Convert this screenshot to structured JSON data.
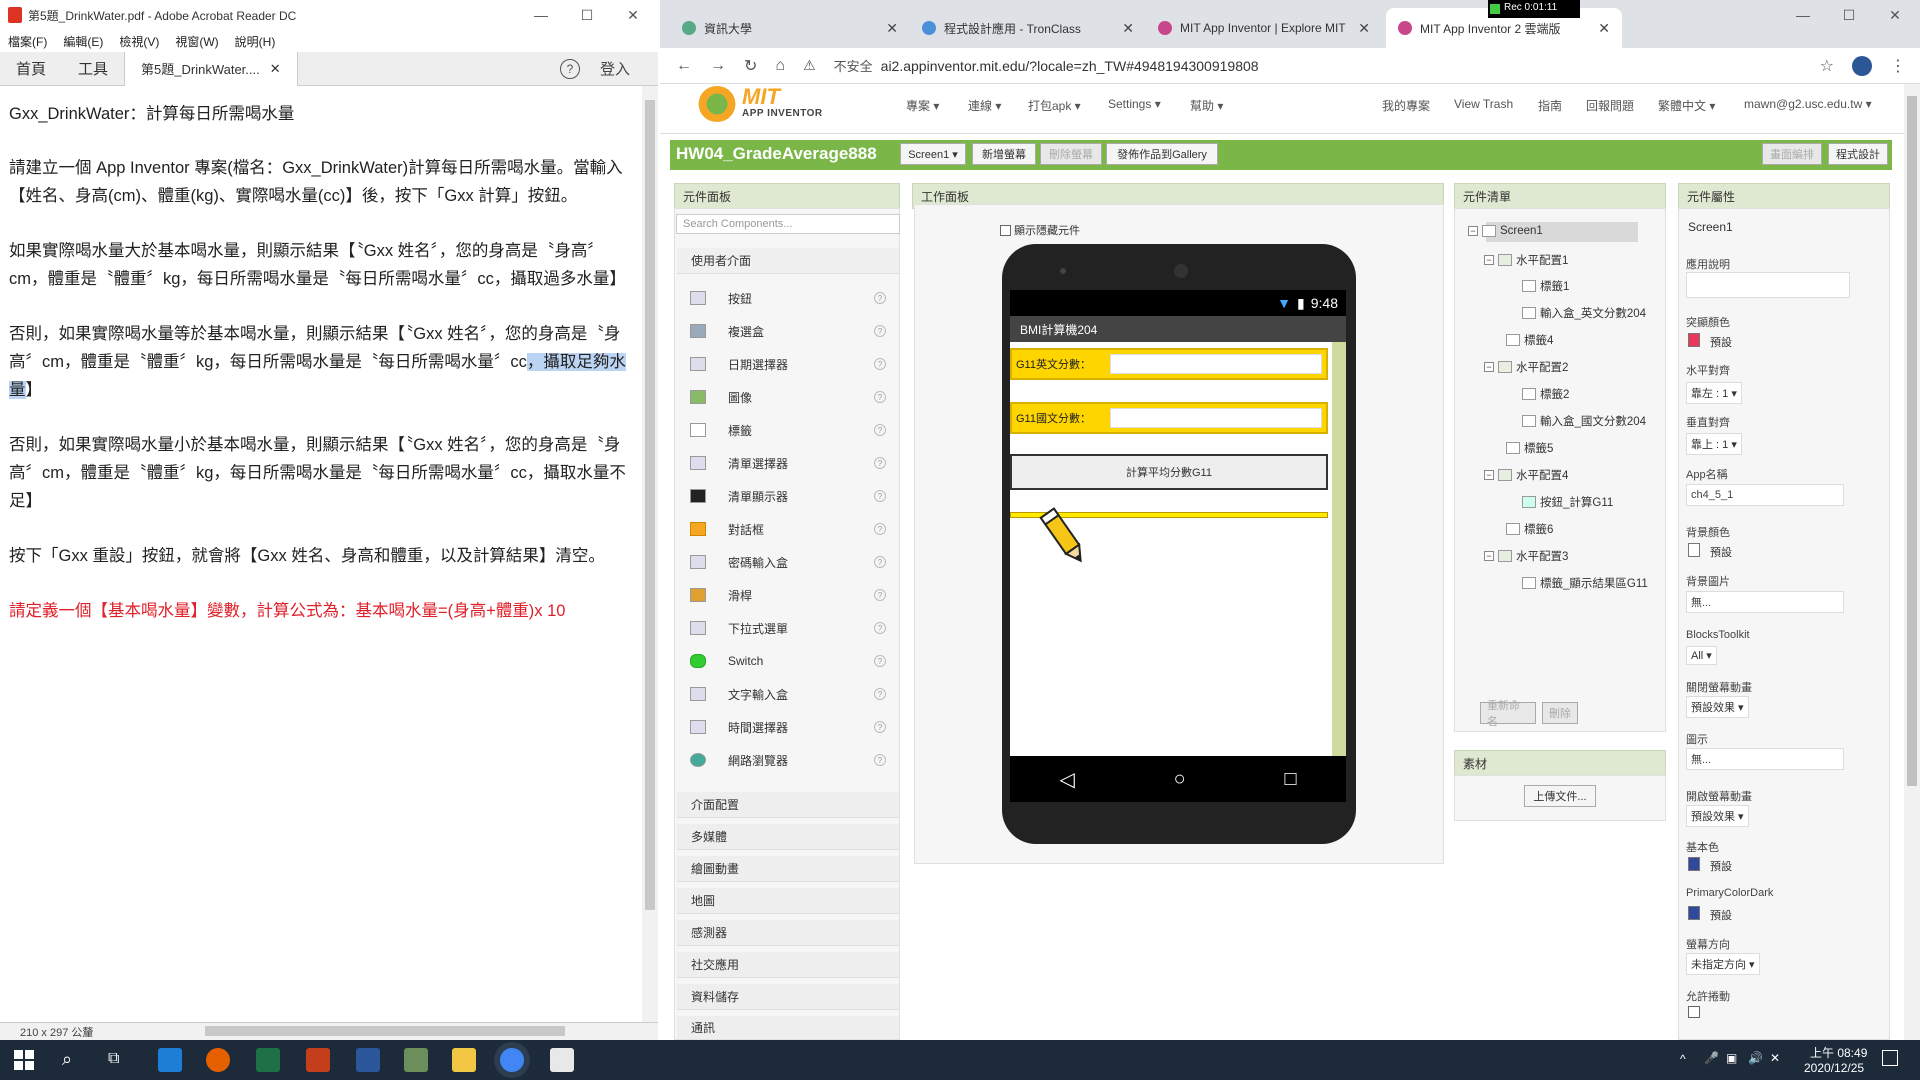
{
  "acrobat": {
    "title": "第5題_DrinkWater.pdf - Adobe Acrobat Reader DC",
    "menu": [
      "檔案(F)",
      "編輯(E)",
      "檢視(V)",
      "視窗(W)",
      "說明(H)"
    ],
    "tabs": {
      "home": "首頁",
      "tools": "工具",
      "doc": "第5題_DrinkWater....",
      "login": "登入"
    },
    "doc": {
      "p1": "Gxx_DrinkWater：計算每日所需喝水量",
      "p2": "請建立一個 App Inventor 專案(檔名：Gxx_DrinkWater)計算每日所需喝水量。當輸入【姓名、身高(cm)、體重(kg)、實際喝水量(cc)】後，按下「Gxx 計算」按鈕。",
      "p3": "如果實際喝水量大於基本喝水量，則顯示結果【〝Gxx 姓名〞，您的身高是〝身高〞cm，體重是〝體重〞kg，每日所需喝水量是〝每日所需喝水量〞cc，攝取過多水量】",
      "p4a": "否則，如果實際喝水量等於基本喝水量，則顯示結果【〝Gxx 姓名〞，您的身高是〝身高〞cm，體重是〝體重〞kg，每日所需喝水量是〝每日所需喝水量〞cc",
      "p4b": "，攝取足夠水量",
      "p4c": "】",
      "p5": "否則，如果實際喝水量小於基本喝水量，則顯示結果【〝Gxx 姓名〞，您的身高是〝身高〞cm，體重是〝體重〞kg，每日所需喝水量是〝每日所需喝水量〞cc，攝取水量不足】",
      "p6": "按下「Gxx 重設」按鈕，就會將【Gxx 姓名、身高和體重，以及計算結果】清空。",
      "p7": "請定義一個【基本喝水量】變數，計算公式為：基本喝水量=(身高+體重)x 10"
    },
    "status": "210 x 297 公釐"
  },
  "chrome": {
    "tabs": [
      "資訊大學",
      "程式設計應用 - TronClass",
      "MIT App Inventor | Explore MIT",
      "MIT App Inventor 2 雲端版"
    ],
    "not_secure": "不安全",
    "url": "ai2.appinventor.mit.edu/?locale=zh_TW#4948194300919808",
    "rec": "Rec 0:01:11"
  },
  "ai": {
    "logo_main": "MIT",
    "logo_sub": "APP INVENTOR",
    "menus": [
      "專案 ▾",
      "連線 ▾",
      "打包apk ▾",
      "Settings ▾",
      "幫助 ▾"
    ],
    "right_menus": [
      "我的專案",
      "View Trash",
      "指南",
      "回報問題",
      "繁體中文 ▾",
      "mawn@g2.usc.edu.tw ▾"
    ],
    "project": "HW04_GradeAverage888",
    "buttons": [
      "Screen1 ▾",
      "新增螢幕",
      "刪除螢幕",
      "發佈作品到Gallery"
    ],
    "right_buttons": [
      "畫面編排",
      "程式設計"
    ],
    "palette": {
      "title": "元件面板",
      "search": "Search Components...",
      "ui_cat": "使用者介面",
      "items": [
        "按鈕",
        "複選盒",
        "日期選擇器",
        "圖像",
        "標籤",
        "清單選擇器",
        "清單顯示器",
        "對話框",
        "密碼輸入盒",
        "滑桿",
        "下拉式選單",
        "Switch",
        "文字輸入盒",
        "時間選擇器",
        "網路瀏覽器"
      ],
      "cats": [
        "介面配置",
        "多媒體",
        "繪圖動畫",
        "地圖",
        "感測器",
        "社交應用",
        "資料儲存",
        "通訊"
      ]
    },
    "viewer": {
      "title": "工作面板",
      "checkbox": "顯示隱藏元件",
      "phone_time": "9:48",
      "app_title": "BMI計算機204",
      "row1": "G11英文分數：",
      "row2": "G11國文分數：",
      "button": "計算平均分數G11"
    },
    "tree": {
      "title": "元件清單",
      "nodes": [
        "Screen1",
        "水平配置1",
        "標籤1",
        "輸入盒_英文分數204",
        "標籤4",
        "水平配置2",
        "標籤2",
        "輸入盒_國文分數204",
        "標籤5",
        "水平配置4",
        "按鈕_計算G11",
        "標籤6",
        "水平配置3",
        "標籤_顯示結果區G11"
      ],
      "rename": "重新命名",
      "delete": "刪除",
      "media": "素材",
      "upload": "上傳文件..."
    },
    "props": {
      "title": "元件屬性",
      "component": "Screen1",
      "labels": [
        "應用說明",
        "突顯顏色",
        "水平對齊",
        "垂直對齊",
        "App名稱",
        "背景顏色",
        "背景圖片",
        "BlocksToolkit",
        "關閉螢幕動畫",
        "圖示",
        "開啟螢幕動畫",
        "基本色",
        "PrimaryColorDark",
        "螢幕方向",
        "允許捲動"
      ],
      "accent_label": "預設",
      "halign": "靠左 : 1 ▾",
      "valign": "靠上 : 1 ▾",
      "appname": "ch4_5_1",
      "bg_label": "預設",
      "bgimg": "無...",
      "toolkit": "All ▾",
      "close_anim": "預設效果 ▾",
      "icon": "無...",
      "open_anim": "預設效果 ▾",
      "primary_label": "預設",
      "dark_label": "預設",
      "orient": "未指定方向 ▾"
    }
  },
  "taskbar": {
    "time": "上午 08:49",
    "date": "2020/12/25"
  },
  "colors": {
    "ai_green": "#7ab648",
    "accent": "#e8375a",
    "primary": "#2f4a9c",
    "yellow": "#ffd500"
  }
}
